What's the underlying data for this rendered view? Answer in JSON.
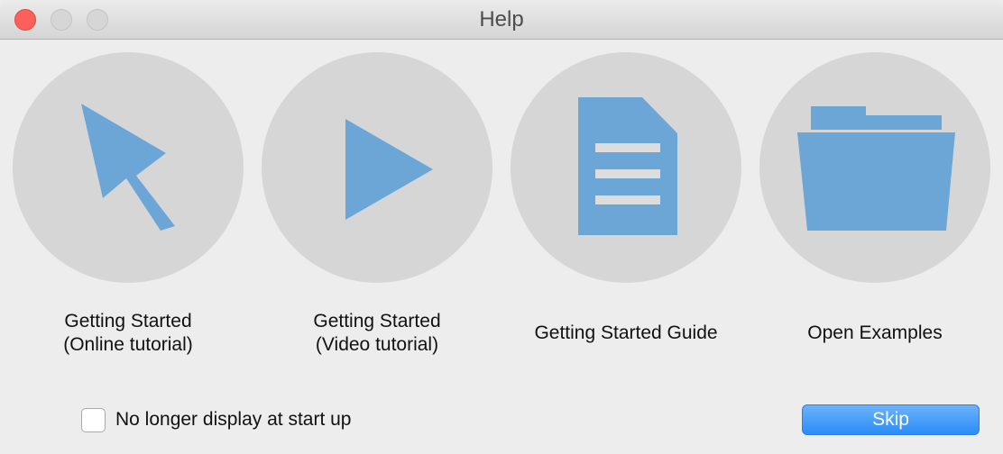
{
  "window": {
    "title": "Help"
  },
  "options": [
    {
      "line1": "Getting Started",
      "line2": "(Online tutorial)",
      "icon": "cursor-arrow-icon"
    },
    {
      "line1": "Getting Started",
      "line2": "(Video tutorial)",
      "icon": "play-icon"
    },
    {
      "line1": "Getting Started Guide",
      "line2": "",
      "icon": "document-icon"
    },
    {
      "line1": "Open Examples",
      "line2": "",
      "icon": "folder-icon"
    }
  ],
  "footer": {
    "checkbox_label": "No longer display at start up",
    "checkbox_checked": false,
    "skip_label": "Skip"
  },
  "colors": {
    "icon_blue": "#6ca6d6",
    "circle_gray": "#d6d6d6",
    "button_blue": "#2a8cf7"
  }
}
